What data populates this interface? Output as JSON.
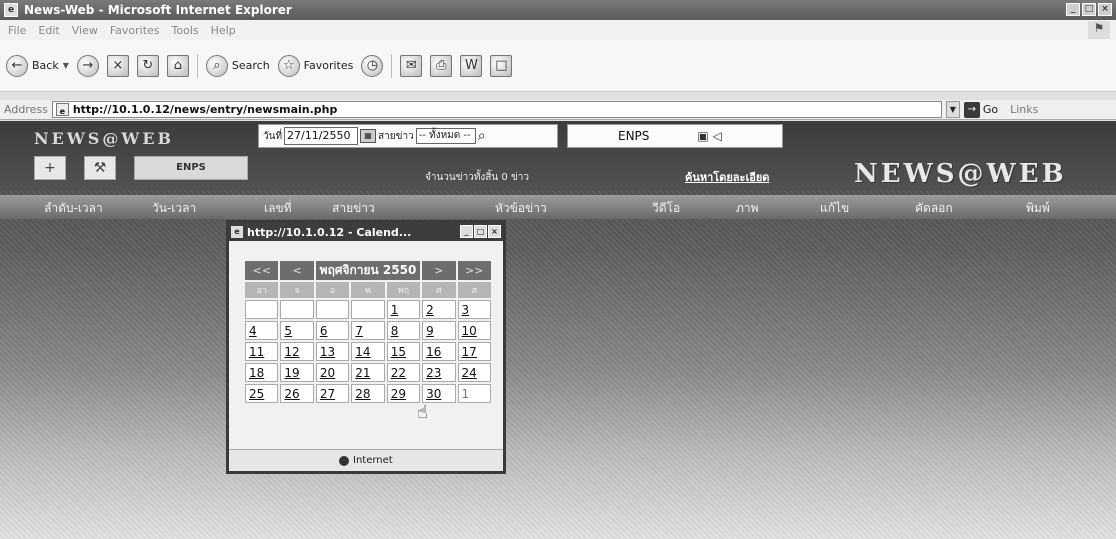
{
  "window": {
    "title": "News-Web - Microsoft Internet Explorer",
    "controls": [
      "_",
      "□",
      "×"
    ]
  },
  "menu": [
    "File",
    "Edit",
    "View",
    "Favorites",
    "Tools",
    "Help"
  ],
  "toolbar": {
    "back": "Back",
    "search": "Search",
    "favorites": "Favorites"
  },
  "address": {
    "label": "Address",
    "url": "http://10.1.0.12/news/entry/newsmain.php",
    "go": "Go",
    "links": "Links"
  },
  "page": {
    "logo": "NEWS@WEB",
    "date_label": "วันที่",
    "date_value": "27/11/2550",
    "line_label": "สายข่าว",
    "line_select": "-- ทั้งหมด --",
    "enps_label": "ENPS",
    "enps_tab": "ENPS",
    "total_text": "จำนวนข่าวทั้งสิ้น 0 ข่าว",
    "advanced_search": "ค้นหาโดยละเอียด",
    "nav": [
      "ลำดับ-เวลา",
      "วัน-เวลา",
      "เลขที่",
      "สายข่าว",
      "หัวข้อข่าว",
      "วีดีโอ",
      "ภาพ",
      "แก้ไข",
      "คัดลอก",
      "พิมพ์"
    ]
  },
  "popup": {
    "title": "http://10.1.0.12 - Calend...",
    "status": "Internet",
    "calendar": {
      "prev_year": "<<",
      "prev_month": "<",
      "month_year": "พฤศจิกายน 2550",
      "next_month": ">",
      "next_year": ">>",
      "weekdays": [
        "อา",
        "จ",
        "อ",
        "พ",
        "พฤ",
        "ศ",
        "ส"
      ],
      "weeks": [
        [
          "",
          "",
          "",
          "",
          "1",
          "2",
          "3"
        ],
        [
          "4",
          "5",
          "6",
          "7",
          "8",
          "9",
          "10"
        ],
        [
          "11",
          "12",
          "13",
          "14",
          "15",
          "16",
          "17"
        ],
        [
          "18",
          "19",
          "20",
          "21",
          "22",
          "23",
          "24"
        ],
        [
          "25",
          "26",
          "27",
          "28",
          "29",
          "30",
          "1"
        ]
      ]
    }
  }
}
